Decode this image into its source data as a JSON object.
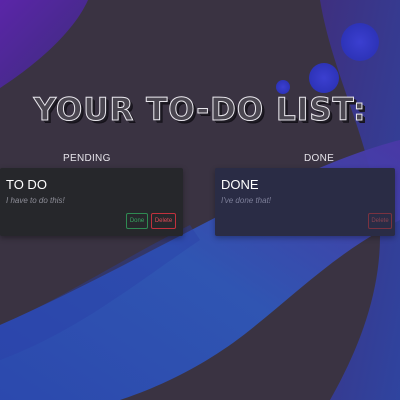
{
  "app": {
    "title": "YOUR TO-DO LIST:"
  },
  "columns": {
    "pending": {
      "heading": "PENDING",
      "items": [
        {
          "title": "TO DO",
          "description": "I have to do this!",
          "done_label": "Done",
          "delete_label": "Delete"
        }
      ]
    },
    "done": {
      "heading": "DONE",
      "items": [
        {
          "title": "DONE",
          "description": "I've done that!",
          "delete_label": "Delete"
        }
      ]
    }
  },
  "colors": {
    "background": "#3b3443",
    "accent_blue": "#2a4fa8",
    "accent_purple": "#5a2aa0",
    "done_button": "#37a660",
    "delete_button": "#e14a56"
  }
}
